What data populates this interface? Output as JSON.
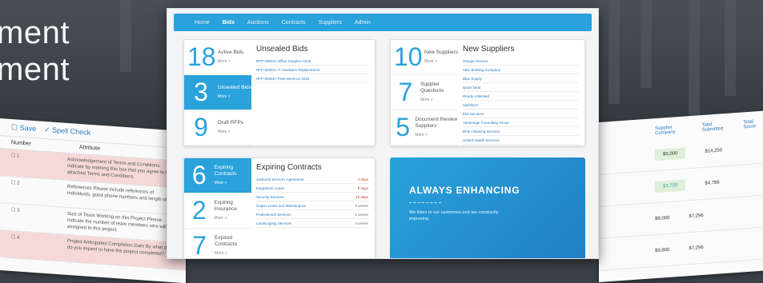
{
  "hero": {
    "line1": "ment",
    "line2": "ment"
  },
  "left_sheet": {
    "toolbar": [
      "Save",
      "Spell Check"
    ],
    "headers": [
      "Number",
      "Attribute"
    ],
    "rows": [
      {
        "num": "1",
        "text": "Acknowledgement of Terms and Conditions. Indicate by marking this box that you agree to the attached Terms and Conditions",
        "pink": true
      },
      {
        "num": "2",
        "text": "References Please include references of individuals, good phone numbers and length of",
        "pink": false
      },
      {
        "num": "3",
        "text": "Size of Team Working on this Project Please indicate the number of team members who will be assigned to this project",
        "pink": false
      },
      {
        "num": "4",
        "text": "Project Anticipated Completion Date By what date do you expect to have the project completed?",
        "pink": true
      }
    ]
  },
  "right_sheet": {
    "headers": [
      "Supplier Company",
      "Total Submitted",
      "Total Score"
    ],
    "rows": [
      {
        "a": "",
        "b": "$5,000",
        "c": "$14,250"
      },
      {
        "a": "",
        "b": "$3,750",
        "c": "$4,786"
      },
      {
        "a": "",
        "b": "$8,000",
        "c": "$7,296"
      },
      {
        "a": "",
        "b": "$9,800",
        "c": "$7,296"
      }
    ]
  },
  "nav": {
    "items": [
      "Home",
      "Bids",
      "Auctions",
      "Contracts",
      "Suppliers",
      "Admin"
    ],
    "active": 1
  },
  "bids_card": {
    "title": "Unsealed Bids",
    "stats": [
      {
        "num": "18",
        "label": "Active Bids",
        "more": "More >",
        "hl": false
      },
      {
        "num": "3",
        "label": "Unsealed Bids",
        "more": "More >",
        "hl": true
      },
      {
        "num": "9",
        "label": "Draft RFPs",
        "more": "More >",
        "hl": false
      }
    ],
    "items": [
      "RFP-000023 Office Supplies 2016",
      "RFP-000041 IT Hardware Replacement",
      "RFP-000057 Fleet Services 2016"
    ]
  },
  "suppliers_card": {
    "title": "New Suppliers",
    "stats": [
      {
        "num": "10",
        "label": "New Suppliers",
        "more": "More >",
        "hl": false
      },
      {
        "num": "7",
        "label": "Supplier Questions",
        "more": "More >",
        "hl": false
      },
      {
        "num": "5",
        "label": "Document Review Suppliers",
        "more": "More >",
        "hl": false
      }
    ],
    "items": [
      "Orange Service",
      "ABC Building Company",
      "Blue Supply",
      "Quick Deal",
      "Ready Unlimited",
      "Swiftlines",
      "Ella Services",
      "Advantage Consulting Group",
      "Brite Cleaning Services",
      "United Health Services"
    ]
  },
  "contracts_card": {
    "title": "Expiring Contracts",
    "stats": [
      {
        "num": "6",
        "label": "Expiring Contracts",
        "more": "More >",
        "hl": true
      },
      {
        "num": "2",
        "label": "Expiring Insurance",
        "more": "More >",
        "hl": false
      },
      {
        "num": "7",
        "label": "Expired Contracts",
        "more": "More >",
        "hl": false
      }
    ],
    "items": [
      {
        "name": "Janitorial Services Agreement",
        "status": "4 days",
        "urgent": true
      },
      {
        "name": "Equipment Lease",
        "status": "8 days",
        "urgent": true
      },
      {
        "name": "Security Services",
        "status": "12 days",
        "urgent": true
      },
      {
        "name": "Copier Lease and Maintenance",
        "status": "5 weeks",
        "urgent": false
      },
      {
        "name": "Professional Services",
        "status": "6 weeks",
        "urgent": false
      },
      {
        "name": "Landscaping Services",
        "status": "8 weeks",
        "urgent": false
      }
    ]
  },
  "promo": {
    "title": "ALWAYS ENHANCING",
    "text": "We listen to our customers and are constantly improving."
  }
}
